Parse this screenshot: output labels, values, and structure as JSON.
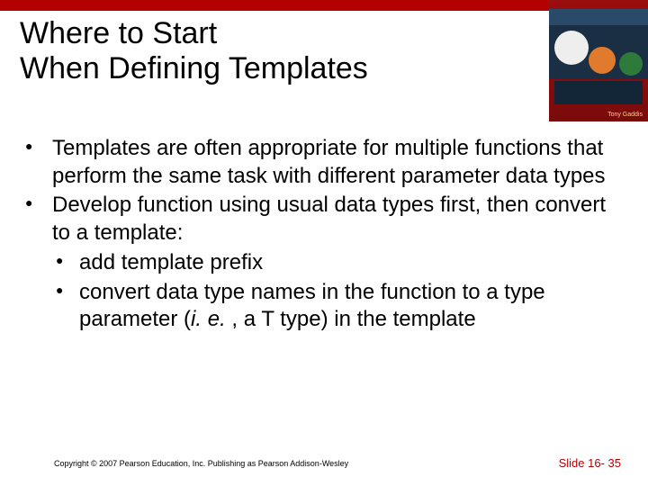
{
  "title_line1": "Where to Start",
  "title_line2": "When Defining Templates",
  "bullets": [
    {
      "level": 1,
      "text": "Templates are often appropriate for multiple functions that perform the same task with different parameter data types"
    },
    {
      "level": 1,
      "text": "Develop function using usual data types first, then convert to a template:"
    },
    {
      "level": 2,
      "text": "add template prefix"
    },
    {
      "level": 2,
      "text_pre": "convert data type names in the function to a type parameter (",
      "text_italic": "i. e.",
      "text_post": " , a T type) in the template"
    }
  ],
  "book": {
    "author": "Tony Gaddis"
  },
  "footer": {
    "copyright": "Copyright © 2007 Pearson Education, Inc. Publishing as Pearson Addison-Wesley",
    "slide_label": "Slide 16- 35"
  }
}
